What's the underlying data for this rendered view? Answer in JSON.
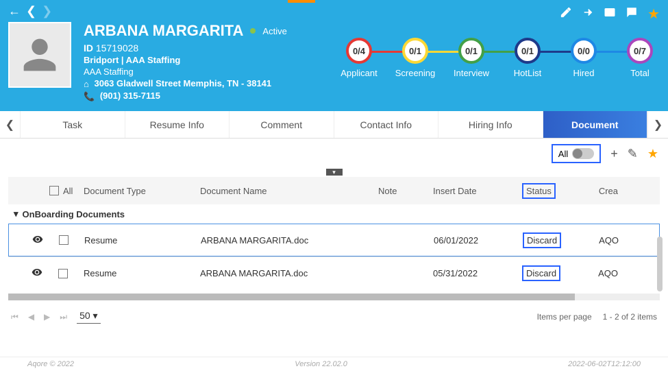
{
  "header": {
    "name": "ARBANA MARGARITA",
    "status": "Active",
    "id_label": "ID",
    "id_value": "15719028",
    "company1": "Bridport | AAA Staffing",
    "company2": "AAA Staffing",
    "address": "3063 Gladwell Street Memphis, TN - 38141",
    "phone": "(901) 315-7115"
  },
  "pipeline": [
    {
      "count": "0/4",
      "label": "Applicant",
      "color": "#e53935",
      "line": "#e53935"
    },
    {
      "count": "0/1",
      "label": "Screening",
      "color": "#fdd835",
      "line": "#fdd835"
    },
    {
      "count": "0/1",
      "label": "Interview",
      "color": "#43a047",
      "line": "#43a047"
    },
    {
      "count": "0/1",
      "label": "HotList",
      "color": "#1e3a8a",
      "line": "#1e3a8a"
    },
    {
      "count": "0/0",
      "label": "Hired",
      "color": "#1e88e5",
      "line": "#1e88e5"
    },
    {
      "count": "0/7",
      "label": "Total",
      "color": "#ab47bc",
      "line": ""
    }
  ],
  "tabs": [
    "Task",
    "Resume Info",
    "Comment",
    "Contact Info",
    "Hiring Info",
    "Document"
  ],
  "actions": {
    "all_label": "All"
  },
  "columns": {
    "all": "All",
    "type": "Document Type",
    "name": "Document Name",
    "note": "Note",
    "date": "Insert Date",
    "status": "Status",
    "created": "Crea"
  },
  "group": "OnBoarding Documents",
  "rows": [
    {
      "type": "Resume",
      "name": "ARBANA MARGARITA.doc",
      "note": "",
      "date": "06/01/2022",
      "status": "Discard",
      "created": "AQO"
    },
    {
      "type": "Resume",
      "name": "ARBANA MARGARITA.doc",
      "note": "",
      "date": "05/31/2022",
      "status": "Discard",
      "created": "AQO"
    }
  ],
  "pager": {
    "page_size": "50",
    "items_label": "Items per page",
    "range": "1 - 2 of 2 items"
  },
  "footer": {
    "copyright": "Aqore © 2022",
    "version": "Version 22.02.0",
    "timestamp": "2022-06-02T12:12:00"
  }
}
